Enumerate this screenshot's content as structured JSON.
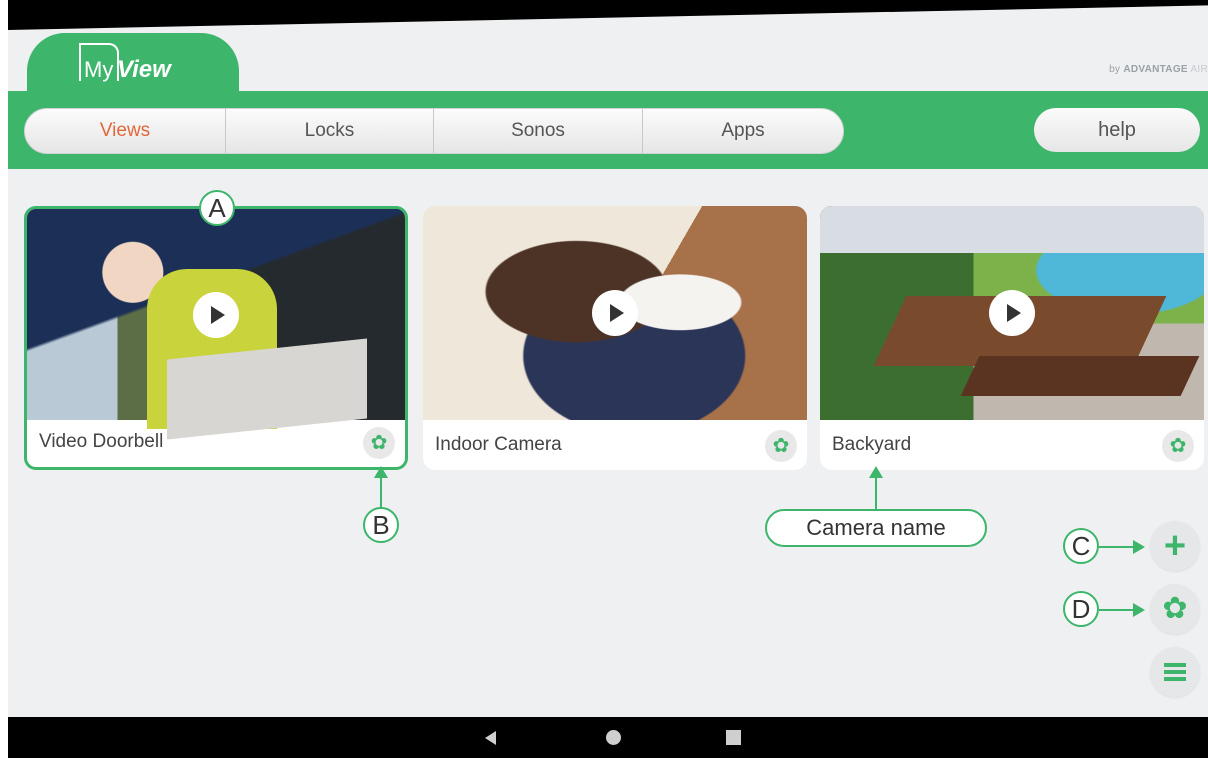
{
  "app": {
    "logo_my": "My",
    "logo_view": "View",
    "brand_prefix": "by",
    "brand_name": "ADVANTAGE",
    "brand_suffix": "AIR"
  },
  "tabs": [
    {
      "label": "Views",
      "active": true
    },
    {
      "label": "Locks",
      "active": false
    },
    {
      "label": "Sonos",
      "active": false
    },
    {
      "label": "Apps",
      "active": false
    }
  ],
  "help_label": "help",
  "cameras": [
    {
      "name": "Video Doorbell",
      "selected": true
    },
    {
      "name": "Indoor Camera",
      "selected": false
    },
    {
      "name": "Backyard",
      "selected": false
    }
  ],
  "annotations": {
    "a": "A",
    "b": "B",
    "c": "C",
    "d": "D",
    "camera_name": "Camera name"
  },
  "icons": {
    "settings": "gear-icon",
    "add": "plus-icon",
    "menu": "hamburger-icon",
    "play": "play-icon"
  },
  "colors": {
    "accent_green": "#3db56a",
    "active_tab": "#e0683a",
    "background": "#eef0f2"
  }
}
